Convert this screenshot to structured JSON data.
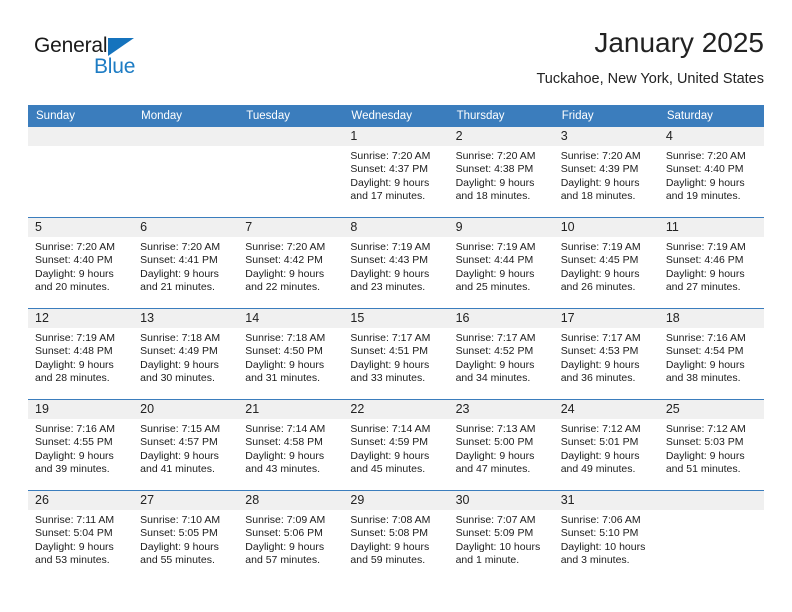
{
  "brand": {
    "name_part1": "General",
    "name_part2": "Blue",
    "triangle_color": "#1573bd",
    "blue_text_color": "#1d7cc4"
  },
  "header": {
    "title": "January 2025",
    "location": "Tuckahoe, New York, United States"
  },
  "theme": {
    "header_row_bg": "#3b7dbd",
    "daynum_band_bg": "#f0f0f0",
    "grid_line": "#3b7dbd",
    "cell_bg": "#ffffff"
  },
  "weekday_headers": [
    "Sunday",
    "Monday",
    "Tuesday",
    "Wednesday",
    "Thursday",
    "Friday",
    "Saturday"
  ],
  "weeks": [
    [
      {
        "day": "",
        "empty": true
      },
      {
        "day": "",
        "empty": true
      },
      {
        "day": "",
        "empty": true
      },
      {
        "day": "1",
        "sunrise": "Sunrise: 7:20 AM",
        "sunset": "Sunset: 4:37 PM",
        "daylight1": "Daylight: 9 hours",
        "daylight2": "and 17 minutes."
      },
      {
        "day": "2",
        "sunrise": "Sunrise: 7:20 AM",
        "sunset": "Sunset: 4:38 PM",
        "daylight1": "Daylight: 9 hours",
        "daylight2": "and 18 minutes."
      },
      {
        "day": "3",
        "sunrise": "Sunrise: 7:20 AM",
        "sunset": "Sunset: 4:39 PM",
        "daylight1": "Daylight: 9 hours",
        "daylight2": "and 18 minutes."
      },
      {
        "day": "4",
        "sunrise": "Sunrise: 7:20 AM",
        "sunset": "Sunset: 4:40 PM",
        "daylight1": "Daylight: 9 hours",
        "daylight2": "and 19 minutes."
      }
    ],
    [
      {
        "day": "5",
        "sunrise": "Sunrise: 7:20 AM",
        "sunset": "Sunset: 4:40 PM",
        "daylight1": "Daylight: 9 hours",
        "daylight2": "and 20 minutes."
      },
      {
        "day": "6",
        "sunrise": "Sunrise: 7:20 AM",
        "sunset": "Sunset: 4:41 PM",
        "daylight1": "Daylight: 9 hours",
        "daylight2": "and 21 minutes."
      },
      {
        "day": "7",
        "sunrise": "Sunrise: 7:20 AM",
        "sunset": "Sunset: 4:42 PM",
        "daylight1": "Daylight: 9 hours",
        "daylight2": "and 22 minutes."
      },
      {
        "day": "8",
        "sunrise": "Sunrise: 7:19 AM",
        "sunset": "Sunset: 4:43 PM",
        "daylight1": "Daylight: 9 hours",
        "daylight2": "and 23 minutes."
      },
      {
        "day": "9",
        "sunrise": "Sunrise: 7:19 AM",
        "sunset": "Sunset: 4:44 PM",
        "daylight1": "Daylight: 9 hours",
        "daylight2": "and 25 minutes."
      },
      {
        "day": "10",
        "sunrise": "Sunrise: 7:19 AM",
        "sunset": "Sunset: 4:45 PM",
        "daylight1": "Daylight: 9 hours",
        "daylight2": "and 26 minutes."
      },
      {
        "day": "11",
        "sunrise": "Sunrise: 7:19 AM",
        "sunset": "Sunset: 4:46 PM",
        "daylight1": "Daylight: 9 hours",
        "daylight2": "and 27 minutes."
      }
    ],
    [
      {
        "day": "12",
        "sunrise": "Sunrise: 7:19 AM",
        "sunset": "Sunset: 4:48 PM",
        "daylight1": "Daylight: 9 hours",
        "daylight2": "and 28 minutes."
      },
      {
        "day": "13",
        "sunrise": "Sunrise: 7:18 AM",
        "sunset": "Sunset: 4:49 PM",
        "daylight1": "Daylight: 9 hours",
        "daylight2": "and 30 minutes."
      },
      {
        "day": "14",
        "sunrise": "Sunrise: 7:18 AM",
        "sunset": "Sunset: 4:50 PM",
        "daylight1": "Daylight: 9 hours",
        "daylight2": "and 31 minutes."
      },
      {
        "day": "15",
        "sunrise": "Sunrise: 7:17 AM",
        "sunset": "Sunset: 4:51 PM",
        "daylight1": "Daylight: 9 hours",
        "daylight2": "and 33 minutes."
      },
      {
        "day": "16",
        "sunrise": "Sunrise: 7:17 AM",
        "sunset": "Sunset: 4:52 PM",
        "daylight1": "Daylight: 9 hours",
        "daylight2": "and 34 minutes."
      },
      {
        "day": "17",
        "sunrise": "Sunrise: 7:17 AM",
        "sunset": "Sunset: 4:53 PM",
        "daylight1": "Daylight: 9 hours",
        "daylight2": "and 36 minutes."
      },
      {
        "day": "18",
        "sunrise": "Sunrise: 7:16 AM",
        "sunset": "Sunset: 4:54 PM",
        "daylight1": "Daylight: 9 hours",
        "daylight2": "and 38 minutes."
      }
    ],
    [
      {
        "day": "19",
        "sunrise": "Sunrise: 7:16 AM",
        "sunset": "Sunset: 4:55 PM",
        "daylight1": "Daylight: 9 hours",
        "daylight2": "and 39 minutes."
      },
      {
        "day": "20",
        "sunrise": "Sunrise: 7:15 AM",
        "sunset": "Sunset: 4:57 PM",
        "daylight1": "Daylight: 9 hours",
        "daylight2": "and 41 minutes."
      },
      {
        "day": "21",
        "sunrise": "Sunrise: 7:14 AM",
        "sunset": "Sunset: 4:58 PM",
        "daylight1": "Daylight: 9 hours",
        "daylight2": "and 43 minutes."
      },
      {
        "day": "22",
        "sunrise": "Sunrise: 7:14 AM",
        "sunset": "Sunset: 4:59 PM",
        "daylight1": "Daylight: 9 hours",
        "daylight2": "and 45 minutes."
      },
      {
        "day": "23",
        "sunrise": "Sunrise: 7:13 AM",
        "sunset": "Sunset: 5:00 PM",
        "daylight1": "Daylight: 9 hours",
        "daylight2": "and 47 minutes."
      },
      {
        "day": "24",
        "sunrise": "Sunrise: 7:12 AM",
        "sunset": "Sunset: 5:01 PM",
        "daylight1": "Daylight: 9 hours",
        "daylight2": "and 49 minutes."
      },
      {
        "day": "25",
        "sunrise": "Sunrise: 7:12 AM",
        "sunset": "Sunset: 5:03 PM",
        "daylight1": "Daylight: 9 hours",
        "daylight2": "and 51 minutes."
      }
    ],
    [
      {
        "day": "26",
        "sunrise": "Sunrise: 7:11 AM",
        "sunset": "Sunset: 5:04 PM",
        "daylight1": "Daylight: 9 hours",
        "daylight2": "and 53 minutes."
      },
      {
        "day": "27",
        "sunrise": "Sunrise: 7:10 AM",
        "sunset": "Sunset: 5:05 PM",
        "daylight1": "Daylight: 9 hours",
        "daylight2": "and 55 minutes."
      },
      {
        "day": "28",
        "sunrise": "Sunrise: 7:09 AM",
        "sunset": "Sunset: 5:06 PM",
        "daylight1": "Daylight: 9 hours",
        "daylight2": "and 57 minutes."
      },
      {
        "day": "29",
        "sunrise": "Sunrise: 7:08 AM",
        "sunset": "Sunset: 5:08 PM",
        "daylight1": "Daylight: 9 hours",
        "daylight2": "and 59 minutes."
      },
      {
        "day": "30",
        "sunrise": "Sunrise: 7:07 AM",
        "sunset": "Sunset: 5:09 PM",
        "daylight1": "Daylight: 10 hours",
        "daylight2": "and 1 minute."
      },
      {
        "day": "31",
        "sunrise": "Sunrise: 7:06 AM",
        "sunset": "Sunset: 5:10 PM",
        "daylight1": "Daylight: 10 hours",
        "daylight2": "and 3 minutes."
      },
      {
        "day": "",
        "empty": true
      }
    ]
  ]
}
